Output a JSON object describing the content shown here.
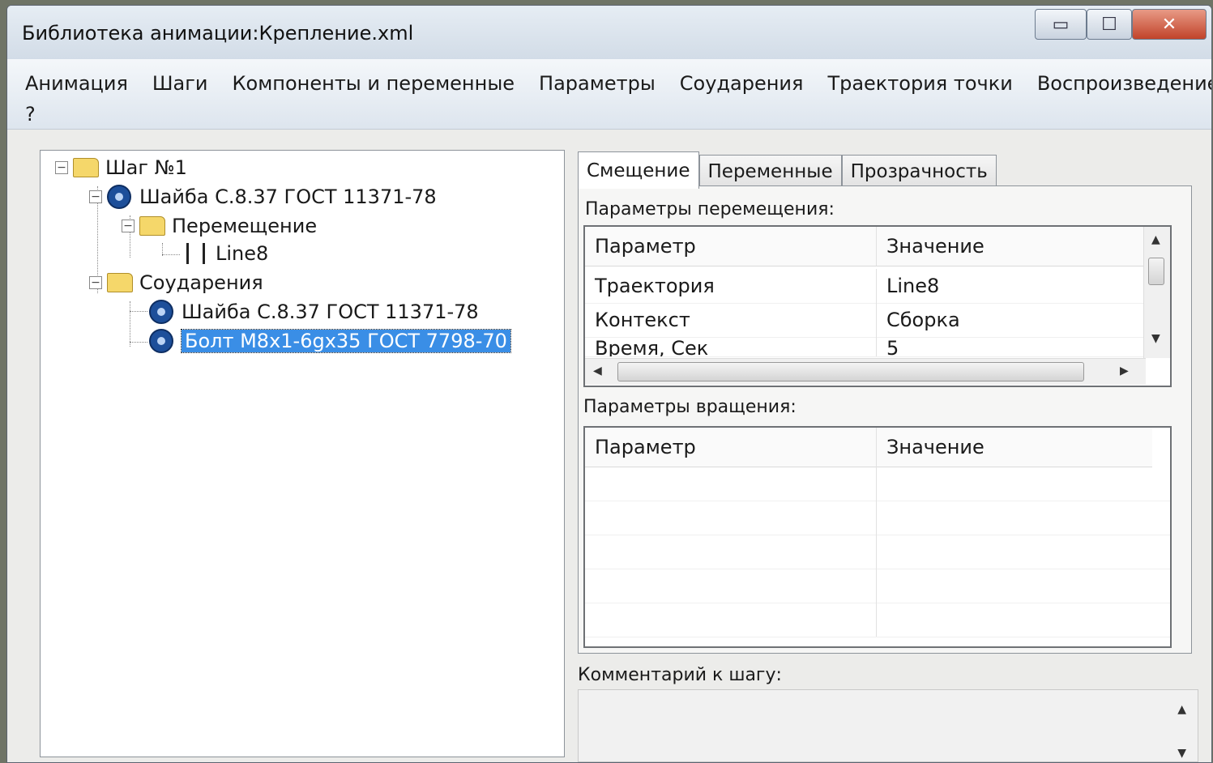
{
  "window": {
    "title": "Библиотека анимации:Крепление.xml"
  },
  "menu": {
    "row1": [
      "Анимация",
      "Шаги",
      "Компоненты и переменные",
      "Параметры",
      "Соударения",
      "Траектория точки",
      "Воспроизведение"
    ],
    "row2": [
      "?"
    ]
  },
  "tree": {
    "step": "Шаг №1",
    "part1": "Шайба С.8.37 ГОСТ 11371-78",
    "move": "Перемещение",
    "line": "Line8",
    "collisions": "Соударения",
    "col_part1": "Шайба С.8.37 ГОСТ 11371-78",
    "col_part2": "Болт М8х1-6gх35 ГОСТ 7798-70"
  },
  "tabs": [
    "Смещение",
    "Переменные",
    "Прозрачность"
  ],
  "move_params": {
    "label": "Параметры перемещения:",
    "headers": [
      "Параметр",
      "Значение"
    ],
    "rows": [
      [
        "Траектория",
        "Line8"
      ],
      [
        "Контекст",
        "Сборка"
      ],
      [
        "Время, Сек",
        "5"
      ]
    ]
  },
  "rotation_params": {
    "label": "Параметры вращения:",
    "headers": [
      "Параметр",
      "Значение"
    ]
  },
  "comment": {
    "label": "Комментарий к шагу:"
  }
}
